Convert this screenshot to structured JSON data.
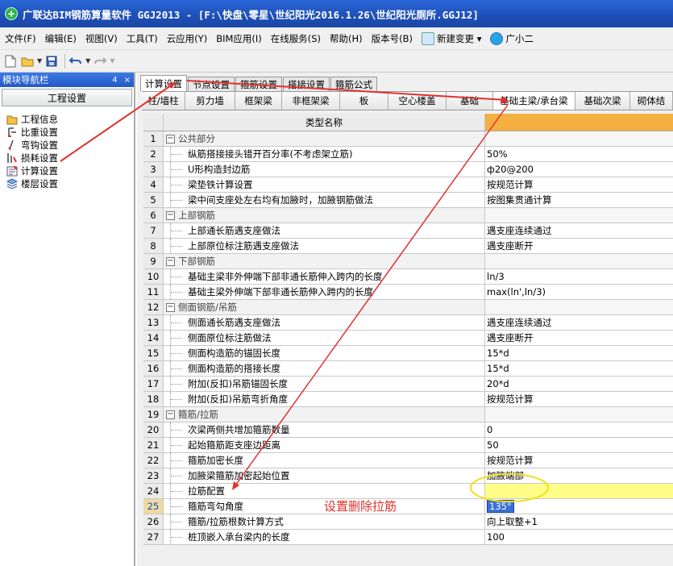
{
  "window": {
    "title": "广联达BIM钢筋算量软件 GGJ2013 - [F:\\快盘\\零星\\世纪阳光2016.1.26\\世纪阳光厕所.GGJ12]"
  },
  "menu": [
    {
      "label": "文件(F)"
    },
    {
      "label": "编辑(E)"
    },
    {
      "label": "视图(V)"
    },
    {
      "label": "工具(T)"
    },
    {
      "label": "云应用(Y)"
    },
    {
      "label": "BIM应用(I)"
    },
    {
      "label": "在线服务(S)"
    },
    {
      "label": "帮助(H)"
    },
    {
      "label": "版本号(B)"
    },
    {
      "label": "新建变更 ▾"
    },
    {
      "label": "广小二"
    }
  ],
  "left_panel": {
    "title": "模块导航栏",
    "pin": "4",
    "close": "×",
    "header": "工程设置",
    "items": [
      {
        "label": "工程信息",
        "icon": "project-info-icon"
      },
      {
        "label": "比重设置",
        "icon": "weight-icon"
      },
      {
        "label": "弯钩设置",
        "icon": "hook-icon"
      },
      {
        "label": "损耗设置",
        "icon": "loss-icon"
      },
      {
        "label": "计算设置",
        "icon": "calc-settings-icon"
      },
      {
        "label": "楼层设置",
        "icon": "floor-icon"
      }
    ]
  },
  "tabs": [
    {
      "label": "计算设置",
      "active": true
    },
    {
      "label": "节点设置"
    },
    {
      "label": "箍筋设置"
    },
    {
      "label": "搭接设置"
    },
    {
      "label": "箍筋公式"
    }
  ],
  "subtabs": [
    {
      "label": "柱/墙柱"
    },
    {
      "label": "剪力墙"
    },
    {
      "label": "框架梁"
    },
    {
      "label": "非框架梁"
    },
    {
      "label": "板"
    },
    {
      "label": "空心楼盖"
    },
    {
      "label": "基础"
    },
    {
      "label": "基础主梁/承台梁",
      "active": true
    },
    {
      "label": "基础次梁"
    },
    {
      "label": "砌体结"
    }
  ],
  "grid": {
    "header": {
      "name": "类型名称",
      "value": ""
    },
    "rows": [
      {
        "n": "1",
        "name": "公共部分",
        "group": true,
        "value": ""
      },
      {
        "n": "2",
        "name": "纵筋搭接接头错开百分率(不考虑架立筋)",
        "value": "50%"
      },
      {
        "n": "3",
        "name": "U形构造封边筋",
        "value": "ф20@200"
      },
      {
        "n": "4",
        "name": "梁垫铁计算设置",
        "value": "按规范计算"
      },
      {
        "n": "5",
        "name": "梁中间支座处左右均有加腋时，加腋钢筋做法",
        "value": "按图集贯通计算"
      },
      {
        "n": "6",
        "name": "上部钢筋",
        "group": true,
        "value": ""
      },
      {
        "n": "7",
        "name": "上部通长筋遇支座做法",
        "value": "遇支座连续通过"
      },
      {
        "n": "8",
        "name": "上部原位标注筋遇支座做法",
        "value": "遇支座断开"
      },
      {
        "n": "9",
        "name": "下部钢筋",
        "group": true,
        "value": ""
      },
      {
        "n": "10",
        "name": "基础主梁非外伸端下部非通长筋伸入跨内的长度",
        "value": "ln/3"
      },
      {
        "n": "11",
        "name": "基础主梁外伸端下部非通长筋伸入跨内的长度",
        "value": "max(ln',ln/3)"
      },
      {
        "n": "12",
        "name": "侧面钢筋/吊筋",
        "group": true,
        "value": ""
      },
      {
        "n": "13",
        "name": "侧面通长筋遇支座做法",
        "value": "遇支座连续通过"
      },
      {
        "n": "14",
        "name": "侧面原位标注筋做法",
        "value": "遇支座断开"
      },
      {
        "n": "15",
        "name": "侧面构造筋的锚固长度",
        "value": "15*d"
      },
      {
        "n": "16",
        "name": "侧面构造筋的搭接长度",
        "value": "15*d"
      },
      {
        "n": "17",
        "name": "附加(反扣)吊筋锚固长度",
        "value": "20*d"
      },
      {
        "n": "18",
        "name": "附加(反扣)吊筋弯折角度",
        "value": "按规范计算"
      },
      {
        "n": "19",
        "name": "箍筋/拉筋",
        "group": true,
        "value": ""
      },
      {
        "n": "20",
        "name": "次梁两侧共增加箍筋数量",
        "value": "0"
      },
      {
        "n": "21",
        "name": "起始箍筋距支座边距离",
        "value": "50"
      },
      {
        "n": "22",
        "name": "箍筋加密长度",
        "value": "按规范计算"
      },
      {
        "n": "23",
        "name": "加腋梁箍筋加密起始位置",
        "value": "加腋端部"
      },
      {
        "n": "24",
        "name": "拉筋配置",
        "value": "",
        "highlight": true
      },
      {
        "n": "25",
        "name": "箍筋弯勾角度",
        "value": "135°",
        "active": true
      },
      {
        "n": "26",
        "name": "箍筋/拉筋根数计算方式",
        "value": "向上取整+1"
      },
      {
        "n": "27",
        "name": "桩顶嵌入承台梁内的长度",
        "value": "100"
      }
    ]
  },
  "annotation": {
    "text": "设置删除拉筋",
    "color": "#e0302a"
  }
}
